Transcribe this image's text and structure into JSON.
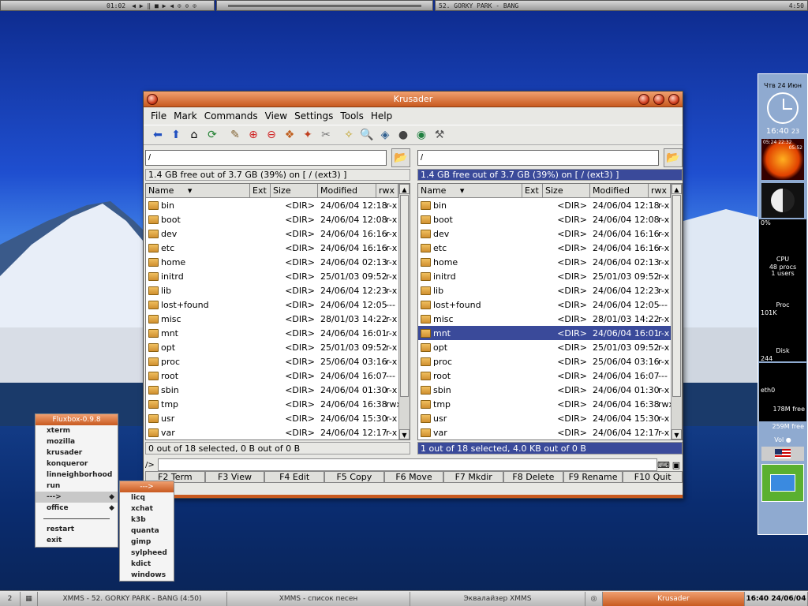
{
  "xmms": {
    "time": "01:02",
    "song": "52. GORKY PARK - BANG",
    "duration": "4:50"
  },
  "window": {
    "title": "Krusader",
    "menu": [
      "File",
      "Mark",
      "Commands",
      "View",
      "Settings",
      "Tools",
      "Help"
    ],
    "toolbar_icons": [
      "back-icon",
      "up-icon",
      "home-icon",
      "refresh-icon",
      "edit-icon",
      "add-icon",
      "remove-icon",
      "pack-icon",
      "unpack-icon",
      "sync-icon",
      "locate-icon",
      "search-icon",
      "compare-icon",
      "terminal-icon",
      "select-icon",
      "config-icon"
    ]
  },
  "left_panel": {
    "path": "/",
    "free": "1.4 GB free out of 3.7 GB (39%) on [ / (ext3) ]",
    "columns": [
      "Name",
      "Ext",
      "Size",
      "Modified",
      "rwx"
    ],
    "selection": "0 out of 18 selected, 0 B out of 0 B",
    "rows": [
      {
        "name": "bin",
        "size": "<DIR>",
        "mod": "24/06/04 12:18",
        "rwx": "r-x"
      },
      {
        "name": "boot",
        "size": "<DIR>",
        "mod": "24/06/04 12:08",
        "rwx": "r-x"
      },
      {
        "name": "dev",
        "size": "<DIR>",
        "mod": "24/06/04 16:16",
        "rwx": "r-x"
      },
      {
        "name": "etc",
        "size": "<DIR>",
        "mod": "24/06/04 16:16",
        "rwx": "r-x"
      },
      {
        "name": "home",
        "size": "<DIR>",
        "mod": "24/06/04 02:13",
        "rwx": "r-x"
      },
      {
        "name": "initrd",
        "size": "<DIR>",
        "mod": "25/01/03 09:52",
        "rwx": "r-x"
      },
      {
        "name": "lib",
        "size": "<DIR>",
        "mod": "24/06/04 12:23",
        "rwx": "r-x"
      },
      {
        "name": "lost+found",
        "size": "<DIR>",
        "mod": "24/06/04 12:05",
        "rwx": "---"
      },
      {
        "name": "misc",
        "size": "<DIR>",
        "mod": "28/01/03 14:22",
        "rwx": "r-x"
      },
      {
        "name": "mnt",
        "size": "<DIR>",
        "mod": "24/06/04 16:01",
        "rwx": "r-x"
      },
      {
        "name": "opt",
        "size": "<DIR>",
        "mod": "25/01/03 09:52",
        "rwx": "r-x"
      },
      {
        "name": "proc",
        "size": "<DIR>",
        "mod": "25/06/04 03:16",
        "rwx": "r-x"
      },
      {
        "name": "root",
        "size": "<DIR>",
        "mod": "24/06/04 16:07",
        "rwx": "---"
      },
      {
        "name": "sbin",
        "size": "<DIR>",
        "mod": "24/06/04 01:30",
        "rwx": "r-x"
      },
      {
        "name": "tmp",
        "size": "<DIR>",
        "mod": "24/06/04 16:38",
        "rwx": "rwx"
      },
      {
        "name": "usr",
        "size": "<DIR>",
        "mod": "24/06/04 15:30",
        "rwx": "r-x"
      },
      {
        "name": "var",
        "size": "<DIR>",
        "mod": "24/06/04 12:17",
        "rwx": "r-x"
      }
    ]
  },
  "right_panel": {
    "path": "/",
    "free": "1.4 GB free out of 3.7 GB (39%) on [ / (ext3) ]",
    "columns": [
      "Name",
      "Ext",
      "Size",
      "Modified",
      "rwx"
    ],
    "selection": "1 out of 18 selected, 4.0 KB out of 0 B",
    "selected_row": "mnt"
  },
  "cmdline": {
    "prompt": "/>",
    "value": ""
  },
  "fkeys": [
    "F2 Term",
    "F3 View",
    "F4 Edit",
    "F5 Copy",
    "F6 Move",
    "F7 Mkdir",
    "F8 Delete",
    "F9 Rename",
    "F10 Quit"
  ],
  "fluxbox": {
    "title": "Fluxbox-0.9.8",
    "items": [
      "xterm",
      "mozilla",
      "krusader",
      "konqueror",
      "linneighborhood",
      "run",
      "--->",
      "office",
      "restart",
      "exit"
    ],
    "submenu_title": "--->",
    "submenu": [
      "licq",
      "xchat",
      "k3b",
      "quanta",
      "gimp",
      "sylpheed",
      "kdict",
      "windows"
    ]
  },
  "taskbar": {
    "workspace": "2",
    "tasks": [
      "XMMS - 52. GORKY PARK - BANG (4:50)",
      "XMMS - список песен",
      "Эквалайзер XMMS",
      "Krusader"
    ],
    "clock": "16:40 24/06/04"
  },
  "dock": {
    "date": "Чтв 24 Июн",
    "time": "16:40",
    "seconds": "23",
    "cpu": "0%",
    "cpu_label": "CPU",
    "procs": "48 procs",
    "users": "1 users",
    "proc_label": "Proc",
    "proc_val": "101K",
    "disk_label": "Disk",
    "disk_val": "244",
    "net_label": "eth0",
    "mem1": "178M free",
    "mem2": "259M free",
    "vol": "Vol",
    "sun_times": "05:24  22:32",
    "sun_times2": "05:52"
  }
}
